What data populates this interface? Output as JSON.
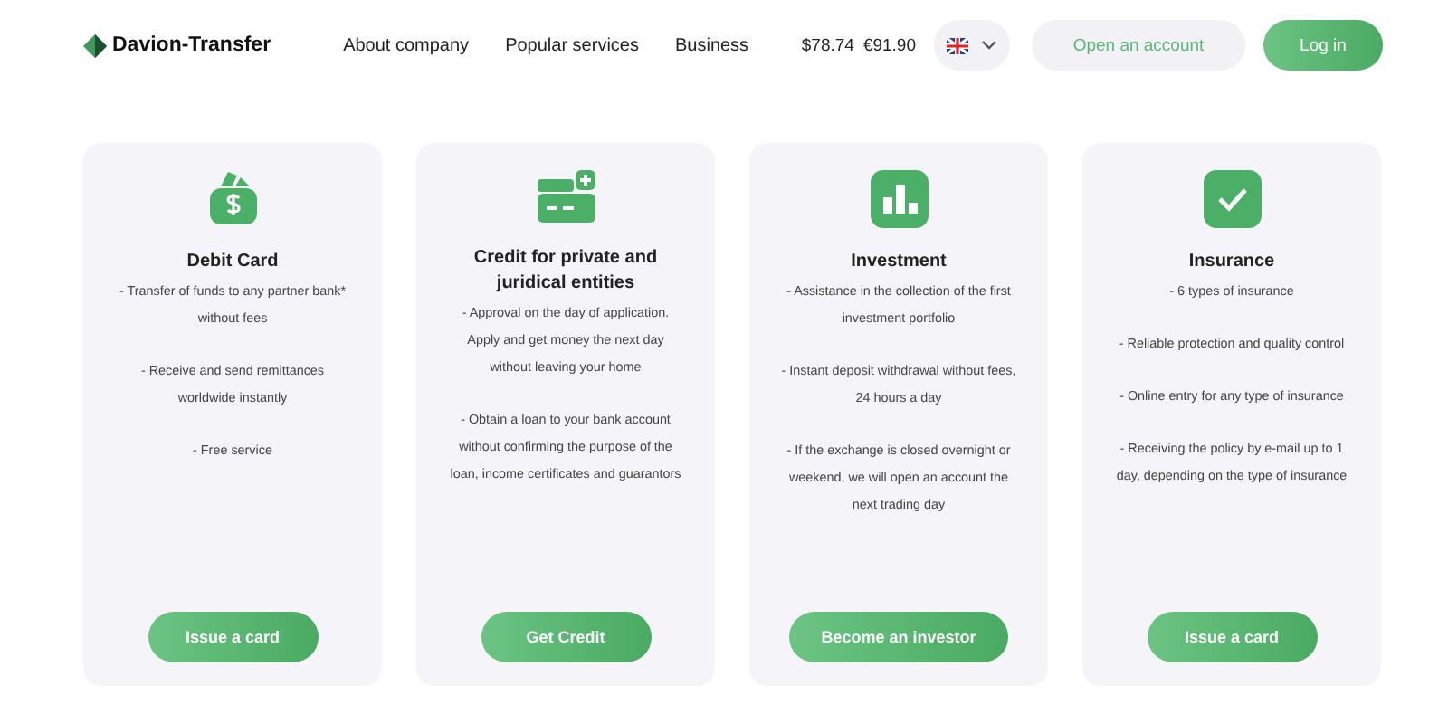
{
  "header": {
    "logo": "Davion-Transfer",
    "nav": [
      "About company",
      "Popular services",
      "Business"
    ],
    "rates": [
      "$78.74",
      "€91.90"
    ],
    "open_account": "Open an account",
    "login": "Log in"
  },
  "cards": [
    {
      "kind": "wallet",
      "title": "Debit Card",
      "points": [
        "- Transfer of funds to any partner bank* without fees",
        "- Receive and send remittances worldwide instantly",
        "- Free service"
      ],
      "button": "Issue a card"
    },
    {
      "kind": "credit",
      "title": "Credit for private and juridical entities",
      "points": [
        "- Approval on the day of application. Apply and get money the next day without leaving your home",
        "- Obtain a loan to your bank account without confirming the purpose of the loan, income certificates and guarantors"
      ],
      "button": "Get Credit"
    },
    {
      "kind": "chart",
      "title": "Investment",
      "points": [
        "- Assistance in the collection of the first investment portfolio",
        "- Instant deposit withdrawal without fees, 24 hours a day",
        "- If the exchange is closed overnight or weekend, we will open an account the next trading day"
      ],
      "button": "Become an investor"
    },
    {
      "kind": "check",
      "title": "Insurance",
      "points": [
        "- 6 types of insurance",
        "- Reliable protection and quality control",
        "- Online entry for any type of insurance",
        "- Receiving the policy by e-mail up to 1 day, depending on the type of insurance"
      ],
      "button": "Issue a card"
    }
  ]
}
